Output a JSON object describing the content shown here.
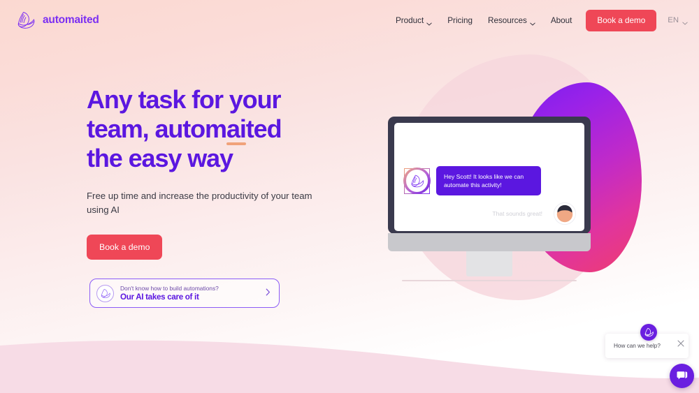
{
  "brand": {
    "name": "automaited",
    "logo_icon": "automaited-swirl-logo",
    "primary_purple": "#5b17e0",
    "accent_red": "#ef4757",
    "accent_orange": "#f0a27a"
  },
  "header": {
    "nav_items": [
      {
        "label": "Product",
        "has_dropdown": true
      },
      {
        "label": "Pricing",
        "has_dropdown": false
      },
      {
        "label": "Resources",
        "has_dropdown": true
      },
      {
        "label": "About",
        "has_dropdown": false
      }
    ],
    "cta_label": "Book a demo",
    "language": "EN"
  },
  "hero": {
    "headline_line1": "Any task for your",
    "headline_line2_pre": "team, autom",
    "headline_line2_highlight": "ai",
    "headline_line2_post": "ted",
    "headline_line3": "the easy way",
    "subhead": "Free up time and increase the productivity of your team using AI",
    "cta_label": "Book a demo",
    "ai_card": {
      "top_text": "Don't know how to build automations?",
      "bottom_text": "Our AI takes care of it",
      "avatar_icon": "automaited-swirl-logo",
      "chevron_icon": "chevron-right-icon"
    }
  },
  "illustration": {
    "chat_message": "Hey Scott! It looks like we can automate this activity!",
    "chat_reply": "That sounds great!",
    "bot_avatar_icon": "automaited-swirl-logo",
    "user_avatar_icon": "person-avatar-icon"
  },
  "chat_widget": {
    "prompt": "How can we help?",
    "close_icon": "close-icon",
    "badge_icon": "automaited-swirl-logo",
    "fab_icon": "chat-bubble-icon"
  }
}
